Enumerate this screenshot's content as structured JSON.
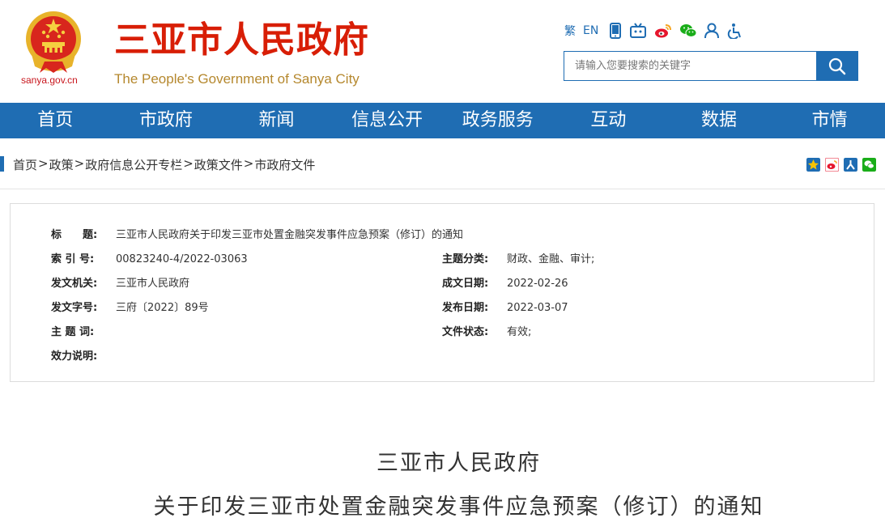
{
  "header": {
    "domain": "sanya.gov.cn",
    "title": "三亚市人民政府",
    "subtitle": "The People's Government of Sanya City",
    "tools": {
      "traditional": "繁",
      "english": "EN"
    },
    "search": {
      "placeholder": "请输入您要搜索的关键字"
    }
  },
  "nav": [
    "首页",
    "市政府",
    "新闻",
    "信息公开",
    "政务服务",
    "互动",
    "数据",
    "市情"
  ],
  "breadcrumb": [
    "首页",
    "政策",
    "政府信息公开专栏",
    "政策文件",
    "市政府文件"
  ],
  "breadcrumb_sep": ">",
  "info": {
    "title_label": "标　　题:",
    "title_value": "三亚市人民政府关于印发三亚市处置金融突发事件应急预案（修订）的通知",
    "index_label": "索 引 号:",
    "index_value": "00823240-4/2022-03063",
    "topic_label": "主题分类:",
    "topic_value": "财政、金融、审计;",
    "issuer_label": "发文机关:",
    "issuer_value": "三亚市人民政府",
    "created_label": "成文日期:",
    "created_value": "2022-02-26",
    "docno_label": "发文字号:",
    "docno_value": "三府〔2022〕89号",
    "published_label": "发布日期:",
    "published_value": "2022-03-07",
    "keywords_label": "主 题 词:",
    "keywords_value": "",
    "status_label": "文件状态:",
    "status_value": "有效;",
    "validity_label": "效力说明:",
    "validity_value": ""
  },
  "document": {
    "title_line1": "三亚市人民政府",
    "title_line2": "关于印发三亚市处置金融突发事件应急预案（修订）的通知"
  },
  "colors": {
    "primary": "#1f6db3",
    "brand_red": "#d81e06",
    "gold": "#b5882e"
  }
}
